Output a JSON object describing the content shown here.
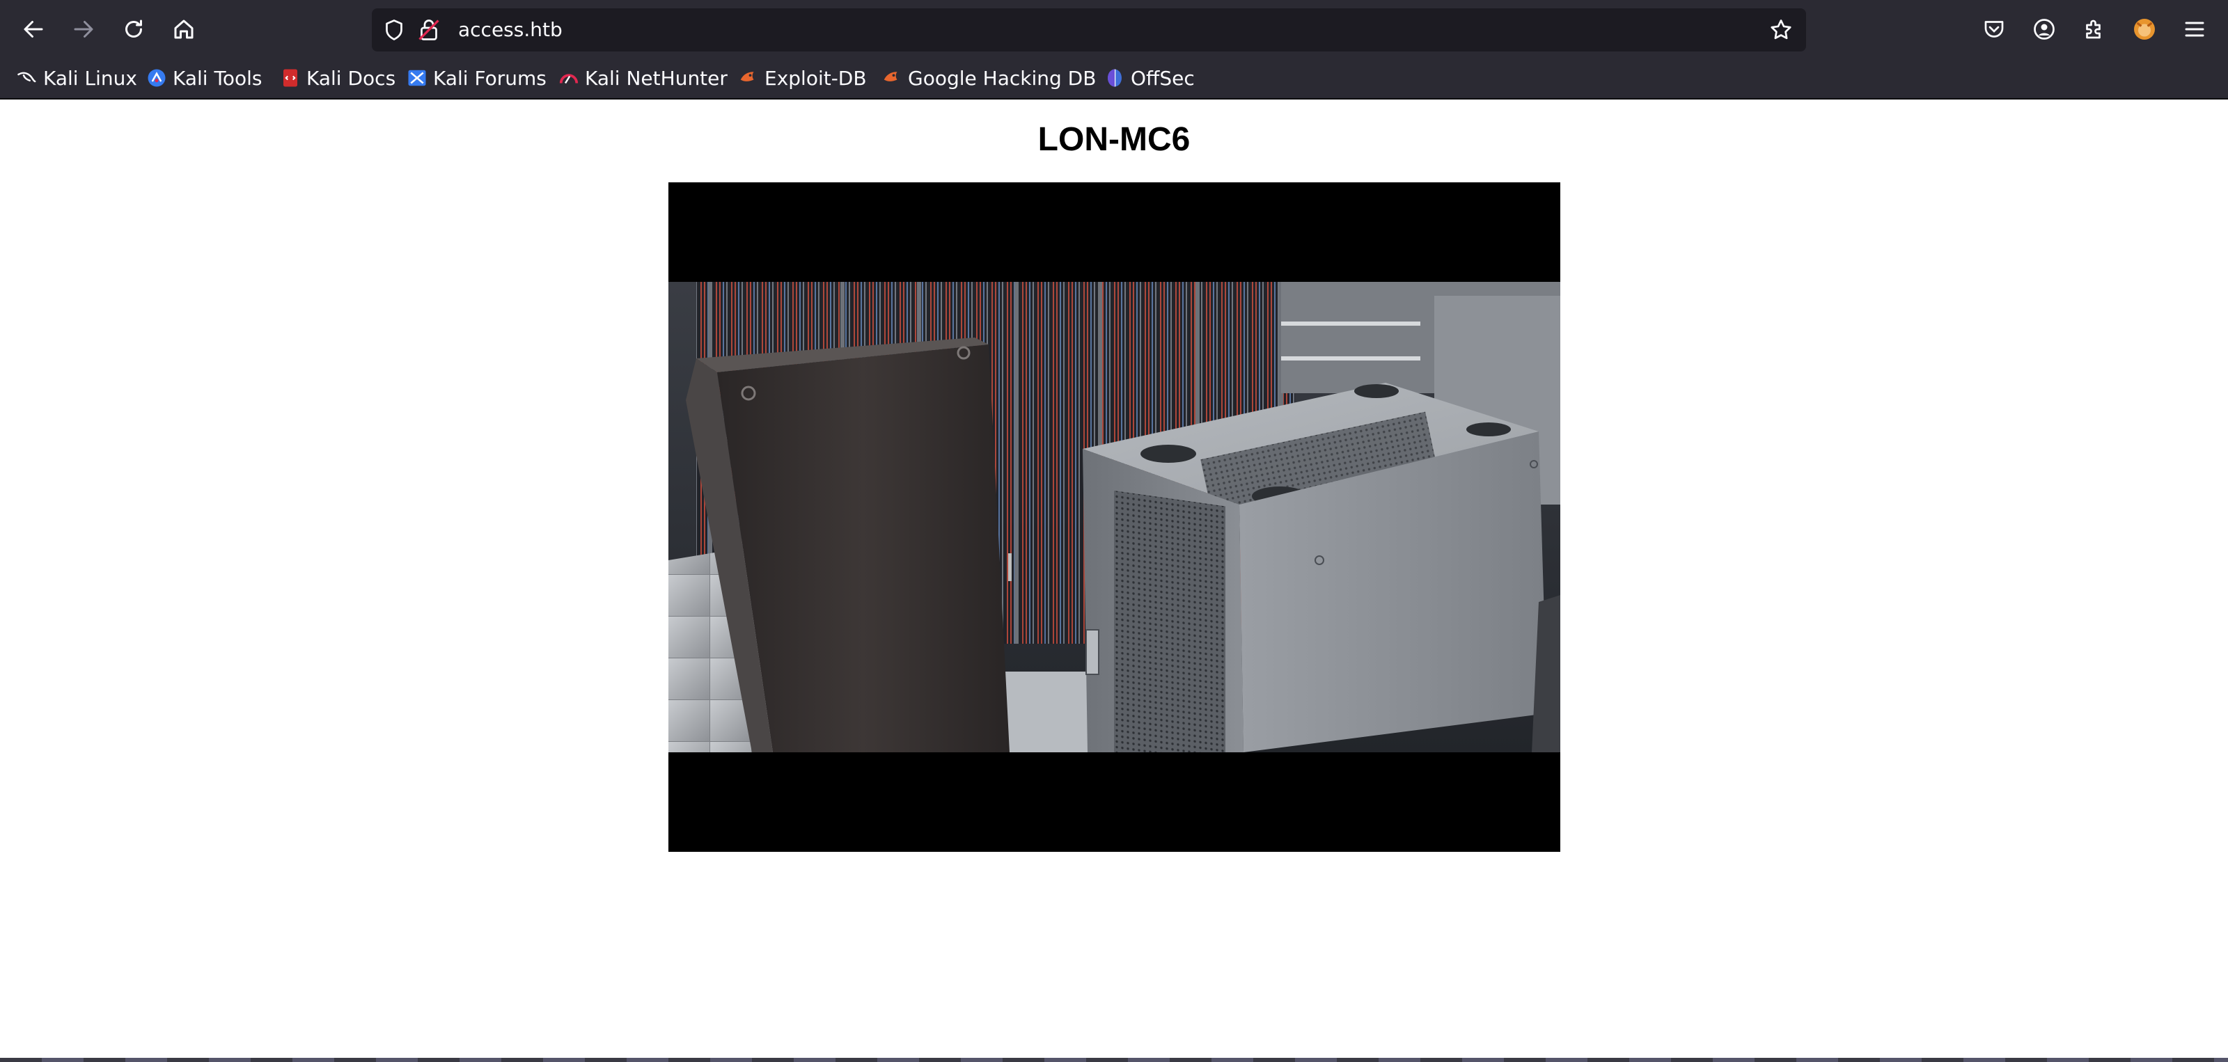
{
  "browser": {
    "url": "access.htb",
    "icons": {
      "back": "arrow-left-icon",
      "forward": "arrow-right-icon",
      "reload": "reload-icon",
      "home": "home-icon",
      "tracking": "shield-icon",
      "insecure": "lock-insecure-icon",
      "bookmark_star": "star-icon",
      "pocket": "pocket-icon",
      "account": "account-icon",
      "extensions": "puzzle-icon",
      "profile": "fox-avatar-icon",
      "menu": "hamburger-menu-icon"
    },
    "bookmarks": [
      {
        "label": "Kali Linux",
        "icon": "kali-dragon-icon"
      },
      {
        "label": "Kali Tools",
        "icon": "kali-tools-icon"
      },
      {
        "label": "Kali Docs",
        "icon": "kali-docs-icon"
      },
      {
        "label": "Kali Forums",
        "icon": "kali-forums-icon"
      },
      {
        "label": "Kali NetHunter",
        "icon": "nethunter-icon"
      },
      {
        "label": "Exploit-DB",
        "icon": "exploit-db-icon"
      },
      {
        "label": "Google Hacking DB",
        "icon": "ghdb-icon"
      },
      {
        "label": "OffSec",
        "icon": "offsec-icon"
      }
    ]
  },
  "page": {
    "title": "LON-MC6",
    "video": {
      "content": "server racks camera feed"
    }
  },
  "colors": {
    "chrome_bg": "#2b2a33",
    "urlbar_bg": "#1c1b22",
    "chrome_text": "#fbfbfe",
    "page_bg": "#ffffff",
    "player_bg": "#000000"
  }
}
